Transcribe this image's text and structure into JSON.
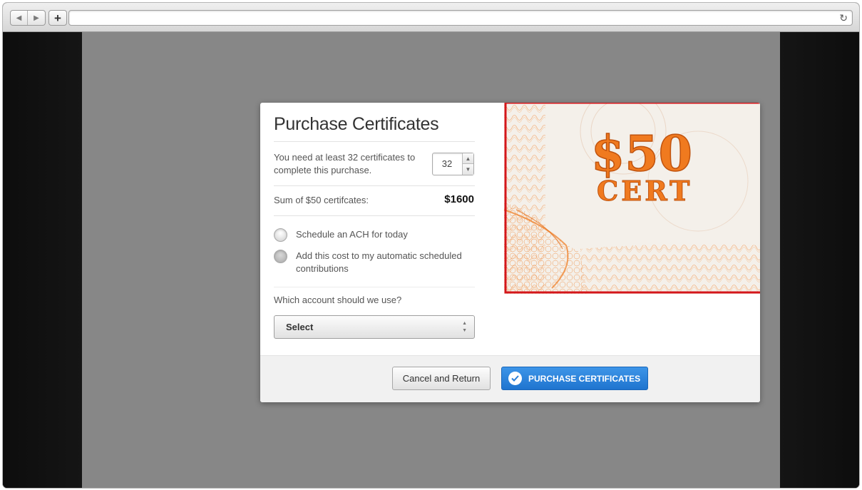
{
  "browser": {
    "back_icon": "back-arrow-icon",
    "forward_icon": "forward-arrow-icon",
    "new_tab_label": "+",
    "url": "",
    "reload_icon": "reload-icon"
  },
  "modal": {
    "title": "Purchase Certificates",
    "requirement_text": "You need at least 32 certificates to complete this purchase.",
    "quantity_value": "32",
    "sum_label": "Sum of $50 certifcates:",
    "sum_value": "$1600",
    "radio_options": [
      {
        "label": "Schedule an ACH for today",
        "selected": false
      },
      {
        "label": "Add this cost to my automatic scheduled contributions",
        "selected": false
      }
    ],
    "account_question": "Which account should we use?",
    "account_select": {
      "selected": "Select"
    },
    "certificate_image": {
      "text_top": "$50",
      "text_bottom": "CERT"
    },
    "footer": {
      "cancel_label": "Cancel and Return",
      "purchase_label": "PURCHASE CERTIFICATES"
    }
  },
  "colors": {
    "overlay": "#878787",
    "primary_button": "#2a7fd8",
    "certificate_orange": "#f07a1f",
    "certificate_border_red": "#d4161b"
  }
}
